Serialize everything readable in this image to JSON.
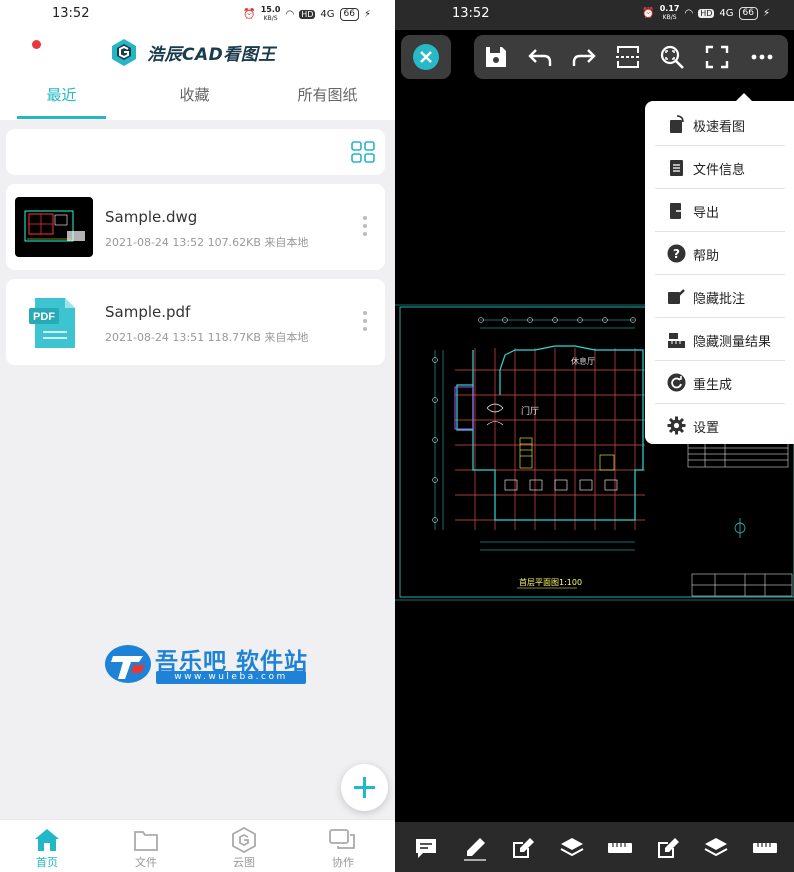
{
  "left": {
    "status": {
      "time": "13:52",
      "speed": "15.0",
      "speed_unit": "KB/S",
      "hd": "HD",
      "net": "4G",
      "battery": "66"
    },
    "app": {
      "title": "浩辰CAD看图王"
    },
    "tabs": [
      "最近",
      "收藏",
      "所有图纸"
    ],
    "files": [
      {
        "name": "Sample.dwg",
        "date": "2021-08-24 13:52",
        "size": "107.62KB",
        "source": "来自本地",
        "thumb_label": ""
      },
      {
        "name": "Sample.pdf",
        "date": "2021-08-24 13:51",
        "size": "118.77KB",
        "source": "来自本地",
        "thumb_label": "PDF"
      }
    ],
    "watermark": {
      "name": "吾乐吧 软件站",
      "url": "www.wuleba.com"
    },
    "nav": [
      {
        "label": "首页",
        "icon": "home-icon"
      },
      {
        "label": "文件",
        "icon": "folder-icon"
      },
      {
        "label": "云图",
        "icon": "cloud-drawing-icon"
      },
      {
        "label": "协作",
        "icon": "chat-icon"
      }
    ],
    "accent": "#22b8c8"
  },
  "right": {
    "status": {
      "time": "13:52",
      "speed": "0.17",
      "speed_unit": "KB/S",
      "hd": "HD",
      "net": "4G",
      "battery": "66"
    },
    "menu": [
      {
        "label": "极速看图",
        "icon": "fast-view-icon"
      },
      {
        "label": "文件信息",
        "icon": "file-info-icon"
      },
      {
        "label": "导出",
        "icon": "export-icon"
      },
      {
        "label": "帮助",
        "icon": "help-icon"
      },
      {
        "label": "隐藏批注",
        "icon": "hide-annotation-icon"
      },
      {
        "label": "隐藏测量结果",
        "icon": "hide-measure-icon"
      },
      {
        "label": "重生成",
        "icon": "regenerate-icon"
      },
      {
        "label": "设置",
        "icon": "settings-icon"
      }
    ],
    "drawing": {
      "hall": "门厅",
      "lounge": "休息厅",
      "plan_title": "首层平面图1:100"
    }
  }
}
